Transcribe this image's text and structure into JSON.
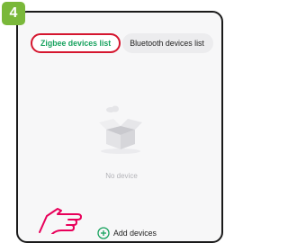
{
  "step": {
    "number": "4"
  },
  "tabs": [
    {
      "label": "Zigbee devices list",
      "active": true
    },
    {
      "label": "Bluetooth devices list",
      "active": false
    }
  ],
  "empty_state": {
    "message": "No device",
    "icon": "empty-box-icon"
  },
  "add_devices": {
    "label": "Add devices",
    "icon": "plus-circle-icon"
  },
  "pointer": {
    "icon": "pointing-hand-icon"
  },
  "colors": {
    "step_badge": "#7ab83a",
    "active_tab_text": "#17a25e",
    "highlight": "#d5162f",
    "hand": "#e8005a",
    "add_icon": "#17a25e"
  }
}
